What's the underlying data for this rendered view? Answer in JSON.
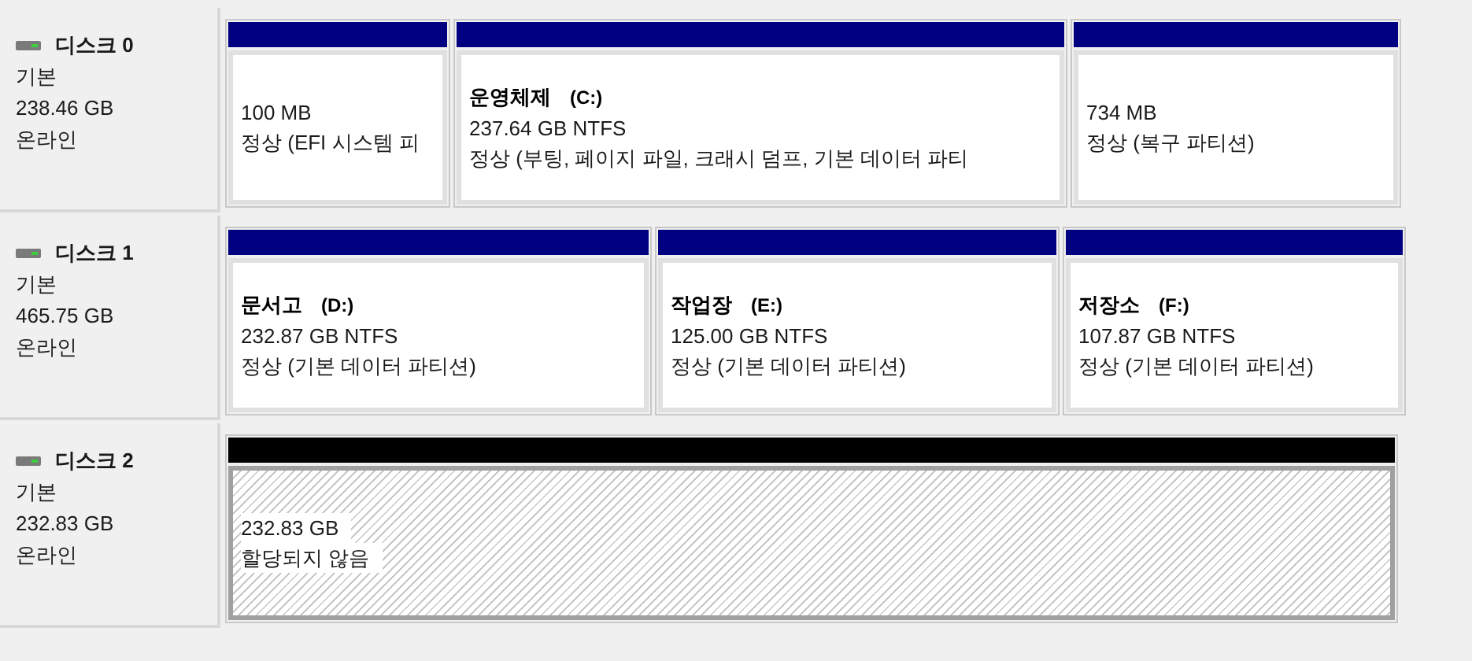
{
  "disks": [
    {
      "name": "디스크 0",
      "type": "기본",
      "size": "238.46 GB",
      "status": "온라인",
      "partitions": [
        {
          "kind": "primary",
          "size": "100 MB",
          "state": "정상 (EFI 시스템 피"
        },
        {
          "kind": "primary",
          "label": "운영체제",
          "letter": "(C:)",
          "size": "237.64 GB NTFS",
          "state": "정상 (부팅, 페이지 파일, 크래시 덤프, 기본 데이터 파티"
        },
        {
          "kind": "primary",
          "size": "734 MB",
          "state": "정상 (복구 파티션)"
        }
      ]
    },
    {
      "name": "디스크 1",
      "type": "기본",
      "size": "465.75 GB",
      "status": "온라인",
      "partitions": [
        {
          "kind": "primary",
          "label": "문서고",
          "letter": "(D:)",
          "size": "232.87 GB NTFS",
          "state": "정상 (기본 데이터 파티션)"
        },
        {
          "kind": "primary",
          "label": "작업장",
          "letter": "(E:)",
          "size": "125.00 GB NTFS",
          "state": "정상 (기본 데이터 파티션)"
        },
        {
          "kind": "primary",
          "label": "저장소",
          "letter": "(F:)",
          "size": "107.87 GB NTFS",
          "state": "정상 (기본 데이터 파티션)"
        }
      ]
    },
    {
      "name": "디스크 2",
      "type": "기본",
      "size": "232.83 GB",
      "status": "온라인",
      "partitions": [
        {
          "kind": "unallocated",
          "size": "232.83 GB",
          "state": "할당되지 않음"
        }
      ]
    }
  ]
}
